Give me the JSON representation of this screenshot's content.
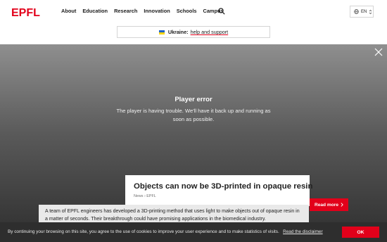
{
  "header": {
    "logo_text": "EPFL",
    "nav": [
      "About",
      "Education",
      "Research",
      "Innovation",
      "Schools",
      "Campus"
    ],
    "language": "EN"
  },
  "notice": {
    "label": "Ukraine:",
    "link_text": "help and support"
  },
  "player": {
    "error_title": "Player error",
    "error_message": "The player is having trouble. We'll have it back up and running as soon as possible."
  },
  "article": {
    "title": "Objects can now be 3D-printed in opaque resin",
    "breadcrumb": [
      "News",
      "EPFL"
    ],
    "read_more": "Read more",
    "summary": "A team of EPFL engineers has developed a 3D-printing method that uses light to make objects out of opaque resin in a matter of seconds. Their breakthrough could have promising applications in the biomedical industry."
  },
  "cookie_banner": {
    "text": "By continuing your browsing on this site, you agree to the use of cookies to improve your user experience and to make statistics of visits.",
    "link": "Read the disclaimer",
    "ok_label": "OK"
  },
  "colors": {
    "accent": "#e2001a",
    "cookie_background": "#2e2e2e"
  },
  "icons": [
    "search-icon",
    "globe-icon",
    "chevron-updown-icon",
    "close-icon",
    "chevron-right-icon"
  ]
}
